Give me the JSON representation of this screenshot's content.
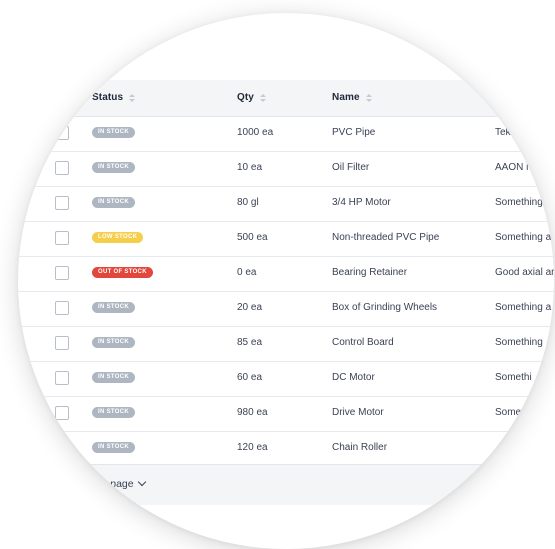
{
  "table": {
    "columns": {
      "status": "Status",
      "qty": "Qty",
      "name": "Name"
    },
    "rows": [
      {
        "status": "IN STOCK",
        "status_type": "in",
        "qty": "1000 ea",
        "name": "PVC Pipe",
        "description": "Tek"
      },
      {
        "status": "IN STOCK",
        "status_type": "in",
        "qty": "10 ea",
        "name": "Oil Filter",
        "description": "AAON i"
      },
      {
        "status": "IN STOCK",
        "status_type": "in",
        "qty": "80 gl",
        "name": "3/4 HP Motor",
        "description": "Something"
      },
      {
        "status": "LOW STOCK",
        "status_type": "low",
        "qty": "500 ea",
        "name": "Non-threaded PVC Pipe",
        "description": "Something a"
      },
      {
        "status": "OUT OF STOCK",
        "status_type": "out",
        "qty": "0 ea",
        "name": "Bearing Retainer",
        "description": "Good axial ar"
      },
      {
        "status": "IN STOCK",
        "status_type": "in",
        "qty": "20 ea",
        "name": "Box of Grinding Wheels",
        "description": "Something a"
      },
      {
        "status": "IN STOCK",
        "status_type": "in",
        "qty": "85 ea",
        "name": "Control Board",
        "description": "Something"
      },
      {
        "status": "IN STOCK",
        "status_type": "in",
        "qty": "60 ea",
        "name": "DC Motor",
        "description": "Somethi"
      },
      {
        "status": "IN STOCK",
        "status_type": "in",
        "qty": "980 ea",
        "name": "Drive Motor",
        "description": "Some"
      },
      {
        "status": "IN STOCK",
        "status_type": "in",
        "qty": "120 ea",
        "name": "Chain Roller",
        "description": ""
      }
    ]
  },
  "footer": {
    "per_page_label": "er page"
  },
  "colors": {
    "in_stock": "#aeb6c2",
    "low_stock": "#f5cf4c",
    "out_of_stock": "#e2463d"
  }
}
